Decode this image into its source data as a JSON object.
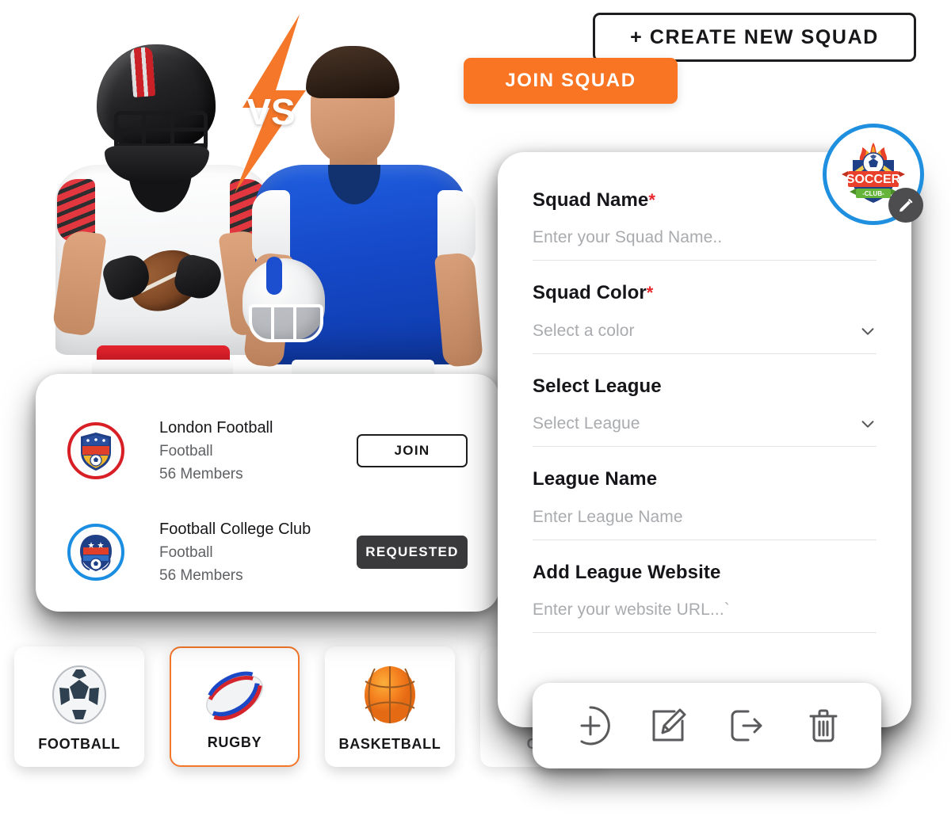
{
  "actions": {
    "create_squad_label": "+ CREATE NEW SQUAD",
    "join_squad_label": "JOIN SQUAD"
  },
  "colors": {
    "accent_orange": "#F97423",
    "dark": "#3A3A3C",
    "badge_ring_blue": "#1F8FE0",
    "required_red": "#E8262D"
  },
  "avatar": {
    "name": "Soccer Club crest",
    "crest_title": "SOCCER",
    "crest_ribbon": "-CLUB-",
    "edit_icon": "pencil-icon"
  },
  "form": {
    "fields": [
      {
        "label": "Squad Name",
        "required": true,
        "placeholder": "Enter your Squad Name..",
        "type": "text"
      },
      {
        "label": "Squad Color",
        "required": true,
        "placeholder": "Select a color",
        "type": "select"
      },
      {
        "label": "Select League",
        "required": false,
        "placeholder": "Select League",
        "type": "select"
      },
      {
        "label": "League Name",
        "required": false,
        "placeholder": "Enter  League Name",
        "type": "text"
      },
      {
        "label": "Add League Website",
        "required": false,
        "placeholder": "Enter your website URL...`",
        "type": "text"
      }
    ],
    "required_marker": "*",
    "chevron_icon": "chevron-down-icon"
  },
  "squads": {
    "rows": [
      {
        "name": "London Football",
        "sport": "Football",
        "members": "56 Members",
        "action_label": "JOIN",
        "action_state": "join",
        "logo_ring": "#D81F26",
        "logo_alt": "football-club-crest"
      },
      {
        "name": "Football College Club",
        "sport": "Football",
        "members": "56 Members",
        "action_label": "REQUESTED",
        "action_state": "requested",
        "logo_ring": "#1B8EE2",
        "logo_alt": "football-college-club-crest"
      }
    ]
  },
  "sport_tabs": [
    {
      "label": "FOOTBALL",
      "icon": "soccer-ball-icon",
      "active": false,
      "faded": false
    },
    {
      "label": "RUGBY",
      "icon": "rugby-ball-icon",
      "active": true,
      "faded": false
    },
    {
      "label": "BASKETBALL",
      "icon": "basketball-icon",
      "active": false,
      "faded": false
    },
    {
      "label": "CRIC",
      "icon": "cricket-ball-icon",
      "active": false,
      "faded": true
    }
  ],
  "toolbar": {
    "buttons": [
      {
        "icon": "add-circle-icon",
        "name": "add-button"
      },
      {
        "icon": "edit-square-icon",
        "name": "edit-button"
      },
      {
        "icon": "exit-icon",
        "name": "leave-button"
      },
      {
        "icon": "trash-icon",
        "name": "delete-button"
      }
    ]
  },
  "hero": {
    "vs_label": "VS",
    "left_player": "american-football-player-white-kit",
    "right_player": "american-football-player-blue-kit"
  }
}
